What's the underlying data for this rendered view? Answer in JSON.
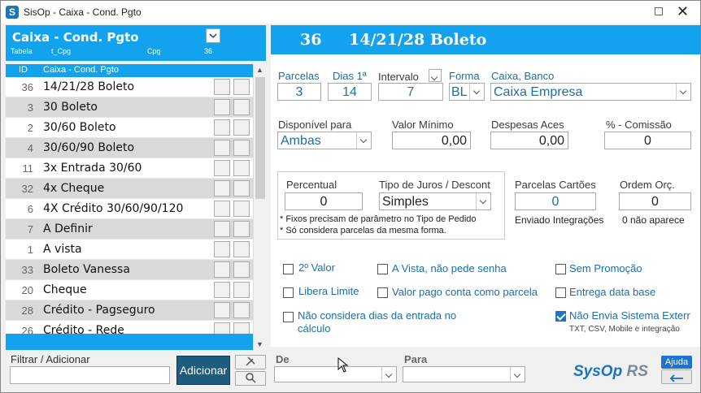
{
  "window": {
    "title": "SisOp - Caixa - Cond. Pgto"
  },
  "left_header": {
    "title": "Caixa - Cond. Pgto",
    "sub_tabela": "Tabela",
    "sub_table": "t_Cpg",
    "sub_code": "Cpg",
    "sub_num": "36"
  },
  "columns": {
    "id": "ID",
    "name": "Caixa - Cond. Pgto"
  },
  "rows": [
    {
      "id": "36",
      "name": "14/21/28 Boleto"
    },
    {
      "id": "3",
      "name": "30 Boleto"
    },
    {
      "id": "2",
      "name": "30/60 Boleto"
    },
    {
      "id": "4",
      "name": "30/60/90 Boleto"
    },
    {
      "id": "11",
      "name": "3x Entrada 30/60"
    },
    {
      "id": "32",
      "name": "4x Cheque"
    },
    {
      "id": "6",
      "name": "4X Crédito 30/60/90/120"
    },
    {
      "id": "7",
      "name": "A Definir"
    },
    {
      "id": "1",
      "name": "A vista"
    },
    {
      "id": "33",
      "name": "Boleto Vanessa"
    },
    {
      "id": "20",
      "name": "Cheque"
    },
    {
      "id": "28",
      "name": "Crédito - Pagseguro"
    },
    {
      "id": "26",
      "name": "Crédito - Rede"
    }
  ],
  "filter": {
    "label": "Filtrar / Adicionar",
    "value": "",
    "add_button": "Adicionar"
  },
  "de_para": {
    "de_label": "De",
    "para_label": "Para"
  },
  "detail": {
    "id": "36",
    "name": "14/21/28 Boleto",
    "parcelas_label": "Parcelas",
    "parcelas": "3",
    "dias_label": "Dias 1ª",
    "dias": "14",
    "intervalo_label": "Intervalo",
    "intervalo": "7",
    "forma_label": "Forma",
    "forma": "BL",
    "caixa_label": "Caixa, Banco",
    "caixa": "Caixa Empresa",
    "disponivel_label": "Disponível para",
    "disponivel": "Ambas",
    "valor_min_label": "Valor Mínimo",
    "valor_min": "0,00",
    "despesas_label": "Despesas  Aces",
    "despesas": "0,00",
    "comissao_label": "% - Comissão",
    "comissao": "0",
    "percentual_label": "Percentual",
    "percentual": "0",
    "juros_label": "Tipo de Juros / Descont",
    "juros": "Simples",
    "parc_cartoes_label": "Parcelas Cartões",
    "parc_cartoes": "0",
    "enviado_label": "Enviado Integrações",
    "ordem_label": "Ordem Orç.",
    "ordem": "0",
    "ordem_note": "0 não aparece",
    "note1": "* Fixos precisam de parâmetro no Tipo de Pedido",
    "note2": "* Só considera parcelas da mesma forma."
  },
  "checks": {
    "segundo_valor": "2º Valor",
    "a_vista": "A Vista, não pede senha",
    "sem_promocao": "Sem Promoção",
    "libera_limite": "Libera Limite",
    "valor_pago": "Valor pago conta como parcela",
    "entrega_data": "Entrega data base",
    "nao_considera_1": "Não considera dias da entrada no",
    "nao_considera_2": "cálculo",
    "nao_envia": "Não Envia Sistema Exterr",
    "nao_envia_sub": "TXT, CSV, Mobile e integração"
  },
  "footer": {
    "brand": "SysOp",
    "brand_rs": "RS",
    "help": "Ajuda"
  },
  "colors": {
    "accent": "#13a3ee",
    "dark_button": "#1e5c7e",
    "brand": "#1b75bb"
  }
}
